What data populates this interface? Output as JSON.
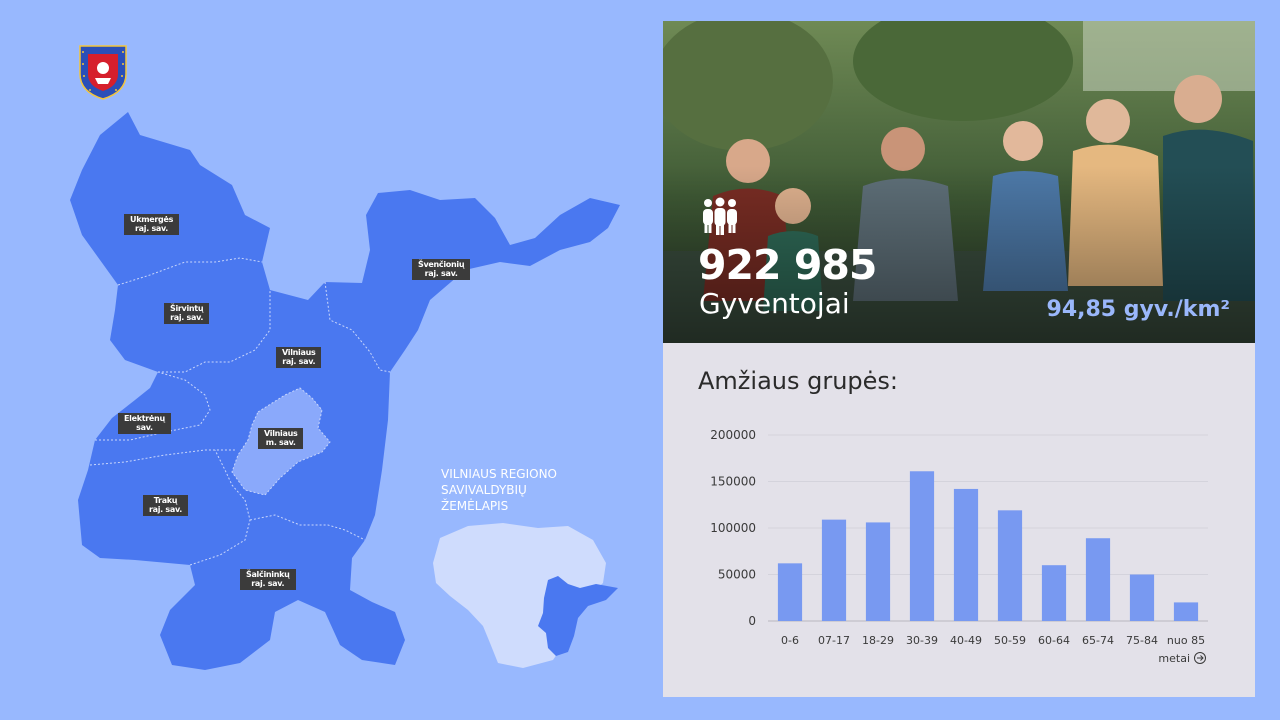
{
  "colors": {
    "background": "#98b8fe",
    "map_fill": "#4a78f0",
    "city_fill": "#8aa9fb",
    "label_bg": "#3b3b3b",
    "panel_bg": "#e3e1e9",
    "bar": "#7899f1",
    "density_text": "#9ab7fb"
  },
  "map": {
    "labels": {
      "ukmerge": "Ukmergės\nraj. sav.",
      "svencioniu": "Švenčionių\nraj. sav.",
      "sirvintu": "Širvintų\nraj. sav.",
      "vilniaus_raj": "Vilniaus\nraj. sav.",
      "elektrenu": "Elektrėnų\nsav.",
      "vilniaus_m": "Vilniaus\nm. sav.",
      "traku": "Trakų\nraj. sav.",
      "salcininku": "Šalčininkų\nraj. sav."
    },
    "caption": "VILNIAUS REGIONO\nSAVIVALDYBIŲ\nŽEMĖLAPIS",
    "crest_icon": "vilnius-county-coat-of-arms"
  },
  "stats": {
    "population": "922 985",
    "population_label": "Gyventojai",
    "density": "94,85 gyv./km²",
    "people_icon": "people-group-icon"
  },
  "chart_title": "Amžiaus grupės:",
  "chart_data": {
    "type": "bar",
    "categories": [
      "0-6",
      "07-17",
      "18-29",
      "30-39",
      "40-49",
      "50-59",
      "60-64",
      "65-74",
      "75-84",
      "nuo 85"
    ],
    "values": [
      62000,
      109000,
      106000,
      161000,
      142000,
      119000,
      60000,
      89000,
      50000,
      20000
    ],
    "ylim": [
      0,
      200000
    ],
    "yticks": [
      "200000",
      "150000",
      "100000",
      "50000",
      "0"
    ],
    "ytick_values": [
      200000,
      150000,
      100000,
      50000,
      0
    ],
    "xlabel": "metai",
    "xlabel_icon": "arrow-right-circle-icon",
    "grid": true
  }
}
